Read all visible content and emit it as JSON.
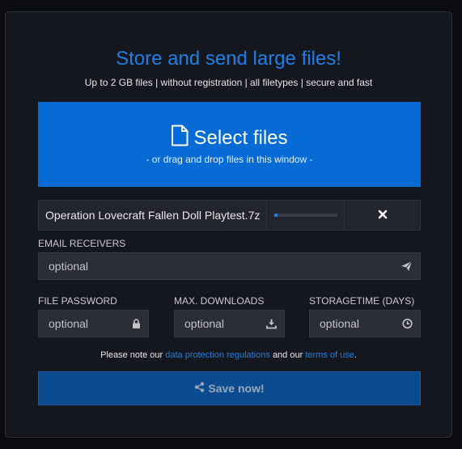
{
  "header": {
    "title": "Store and send large files!",
    "subtitle": "Up to 2 GB files | without registration | all filetypes | secure and fast"
  },
  "dropzone": {
    "label": "Select files",
    "hint": "- or drag and drop files in this window -",
    "icon": "file-icon"
  },
  "file": {
    "name": "Operation Lovecraft Fallen Doll Playtest.7z",
    "progress_percent": 4,
    "remove_icon": "close-icon"
  },
  "email": {
    "label": "EMAIL RECEIVERS",
    "placeholder": "optional",
    "icon": "send-icon"
  },
  "password": {
    "label": "FILE PASSWORD",
    "placeholder": "optional",
    "icon": "lock-icon"
  },
  "downloads": {
    "label": "MAX. DOWNLOADS",
    "placeholder": "optional",
    "icon": "download-icon"
  },
  "storage": {
    "label": "STORAGETIME (DAYS)",
    "placeholder": "optional",
    "icon": "clock-icon"
  },
  "note": {
    "prefix": "Please note our",
    "link1": "data protection regulations",
    "middle": "and our",
    "link2": "terms of use",
    "suffix": "."
  },
  "save": {
    "label": "Save now!",
    "icon": "share-icon"
  },
  "colors": {
    "accent": "#1e7fe6",
    "dropzone": "#066bd4",
    "save_button": "#0a4c8f",
    "background": "#14171d"
  }
}
